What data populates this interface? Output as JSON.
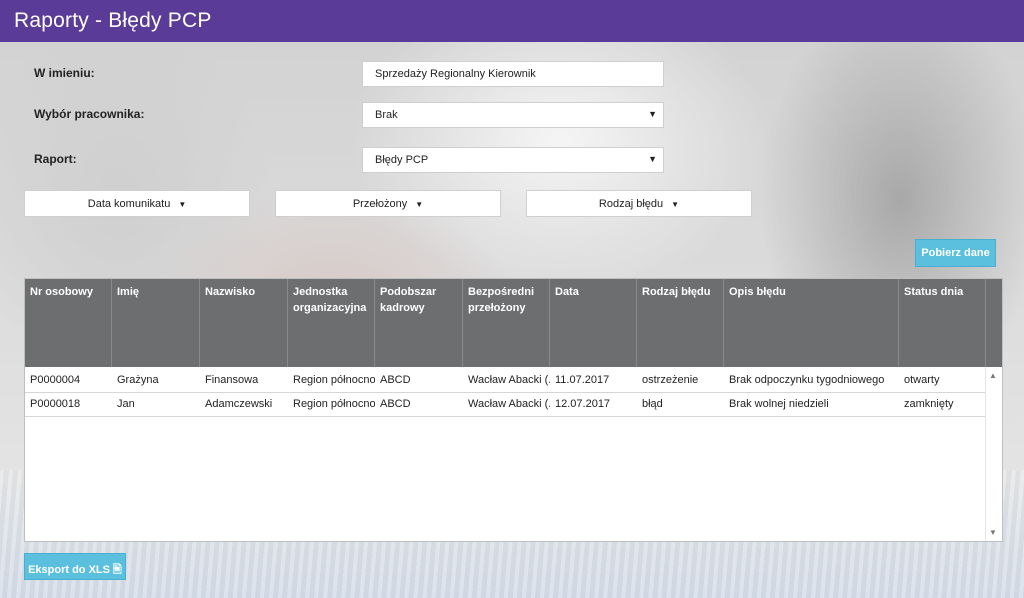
{
  "header": {
    "title": "Raporty - Błędy PCP"
  },
  "form": {
    "on_behalf_label": "W imieniu:",
    "on_behalf_value": "Sprzedaży Regionalny Kierownik",
    "employee_label": "Wybór pracownika:",
    "employee_value": "Brak",
    "report_label": "Raport:",
    "report_value": "Błędy PCP",
    "caret": "▼"
  },
  "filters": {
    "message_date": "Data komunikatu",
    "supervisor": "Przełożony",
    "error_type": "Rodzaj błędu",
    "dropdown_glyph": "▼"
  },
  "actions": {
    "fetch": "Pobierz dane",
    "export": "Eksport do XLS",
    "export_icon": "🖹"
  },
  "table": {
    "columns": [
      "Nr osobowy",
      "Imię",
      "Nazwisko",
      "Jednostka organizacyjna",
      "Podobszar kadrowy",
      "Bezpośredni przełożony",
      "Data",
      "Rodzaj błędu",
      "Opis błędu",
      "Status dnia"
    ],
    "rows": [
      [
        "P0000004",
        "Grażyna",
        "Finansowa",
        "Region północno...",
        "ABCD",
        "Wacław Abacki (...",
        "11.07.2017",
        "ostrzeżenie",
        "Brak odpoczynku tygodniowego",
        "otwarty"
      ],
      [
        "P0000018",
        "Jan",
        "Adamczewski",
        "Region północno...",
        "ABCD",
        "Wacław Abacki (...",
        "12.07.2017",
        "błąd",
        "Brak wolnej niedzieli",
        "zamknięty"
      ]
    ],
    "scroll_up": "▲",
    "scroll_down": "▼"
  },
  "colors": {
    "header_bg": "#5b3b98",
    "table_header_bg": "#6d6e70",
    "button_blue": "#5bc0de"
  }
}
